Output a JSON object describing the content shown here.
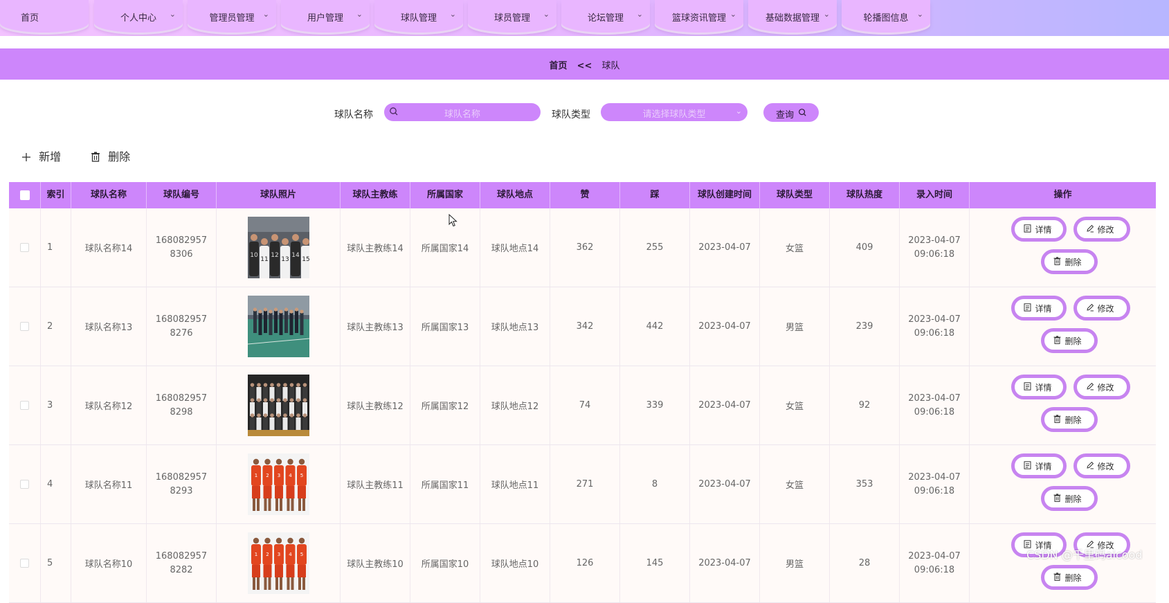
{
  "nav": {
    "items": [
      {
        "label": "首页",
        "has_dropdown": false
      },
      {
        "label": "个人中心",
        "has_dropdown": true
      },
      {
        "label": "管理员管理",
        "has_dropdown": true
      },
      {
        "label": "用户管理",
        "has_dropdown": true
      },
      {
        "label": "球队管理",
        "has_dropdown": true
      },
      {
        "label": "球员管理",
        "has_dropdown": true
      },
      {
        "label": "论坛管理",
        "has_dropdown": true
      },
      {
        "label": "篮球资讯管理",
        "has_dropdown": true
      },
      {
        "label": "基础数据管理",
        "has_dropdown": true
      },
      {
        "label": "轮播图信息",
        "has_dropdown": true
      }
    ]
  },
  "breadcrumb": {
    "home": "首页",
    "separator": "<<",
    "current": "球队"
  },
  "search": {
    "name_label": "球队名称",
    "name_placeholder": "球队名称",
    "type_label": "球队类型",
    "type_placeholder": "请选择球队类型",
    "query_label": "查询"
  },
  "actions": {
    "add_label": "新增",
    "delete_label": "删除"
  },
  "table": {
    "headers": [
      "索引",
      "球队名称",
      "球队编号",
      "球队照片",
      "球队主教练",
      "所属国家",
      "球队地点",
      "赞",
      "踩",
      "球队创建时间",
      "球队类型",
      "球队热度",
      "录入时间",
      "操作"
    ],
    "row_actions": {
      "detail": "详情",
      "edit": "修改",
      "delete": "删除"
    },
    "rows": [
      {
        "index": "1",
        "name": "球队名称14",
        "code": "1680829578306",
        "photo": "huddle-bw",
        "coach": "球队主教练14",
        "country": "所属国家14",
        "location": "球队地点14",
        "likes": "362",
        "dislikes": "255",
        "created": "2023-04-07",
        "type": "女篮",
        "heat": "409",
        "entry_time": "2023-04-07 09:06:18"
      },
      {
        "index": "2",
        "name": "球队名称13",
        "code": "1680829578276",
        "photo": "court-group",
        "coach": "球队主教练13",
        "country": "所属国家13",
        "location": "球队地点13",
        "likes": "342",
        "dislikes": "442",
        "created": "2023-04-07",
        "type": "男篮",
        "heat": "239",
        "entry_time": "2023-04-07 09:06:18"
      },
      {
        "index": "3",
        "name": "球队名称12",
        "code": "1680829578298",
        "photo": "team-photo-dark",
        "coach": "球队主教练12",
        "country": "所属国家12",
        "location": "球队地点12",
        "likes": "74",
        "dislikes": "339",
        "created": "2023-04-07",
        "type": "女篮",
        "heat": "92",
        "entry_time": "2023-04-07 09:06:18"
      },
      {
        "index": "4",
        "name": "球队名称11",
        "code": "1680829578293",
        "photo": "red-uniforms",
        "coach": "球队主教练11",
        "country": "所属国家11",
        "location": "球队地点11",
        "likes": "271",
        "dislikes": "8",
        "created": "2023-04-07",
        "type": "女篮",
        "heat": "353",
        "entry_time": "2023-04-07 09:06:18"
      },
      {
        "index": "5",
        "name": "球队名称10",
        "code": "1680829578282",
        "photo": "red-uniforms",
        "coach": "球队主教练10",
        "country": "所属国家10",
        "location": "球队地点10",
        "likes": "126",
        "dislikes": "145",
        "created": "2023-04-07",
        "type": "男篮",
        "heat": "28",
        "entry_time": "2023-04-07 09:06:18"
      }
    ]
  },
  "watermark": "CSDN @千里码aicood",
  "colors": {
    "accent": "#cd86fb",
    "nav_pill": "#e9b6ff",
    "op_border": "#c784f0",
    "row_bg": "#fffaf8"
  }
}
